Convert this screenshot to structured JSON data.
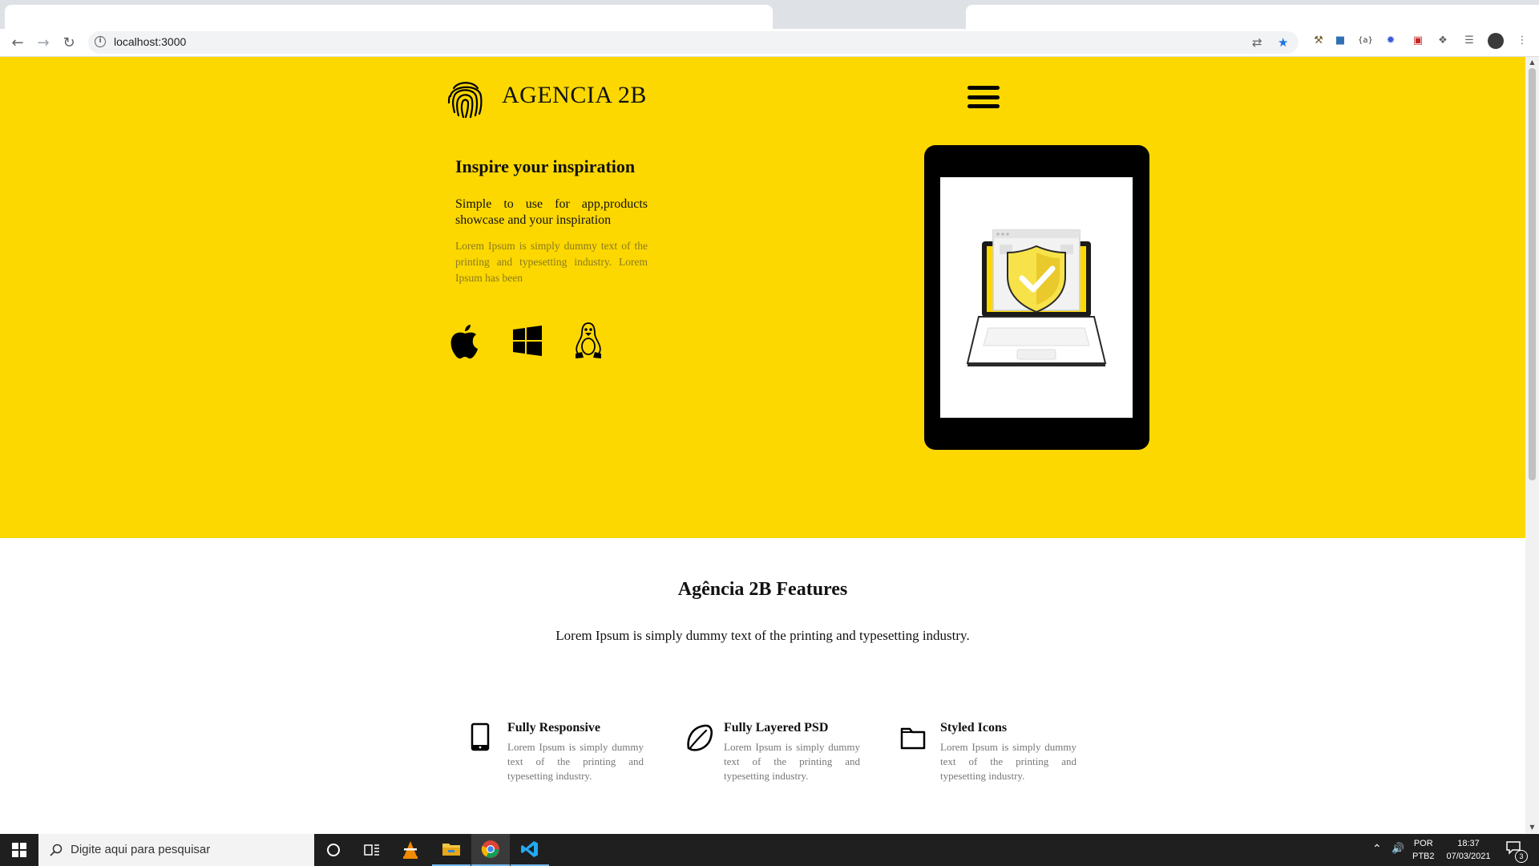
{
  "browser": {
    "url": "localhost:3000"
  },
  "hero": {
    "brand": "AGENCIA 2B",
    "title": "Inspire your inspiration",
    "subtitle": "Simple to use for app,products showcase and your inspiration",
    "description": "Lorem Ipsum is simply dummy text of the printing and typesetting industry. Lorem Ipsum has been",
    "platform_icons": [
      "apple-icon",
      "windows-icon",
      "linux-icon"
    ],
    "background_color": "#fcd800"
  },
  "features": {
    "title": "Agência 2B Features",
    "subtitle": "Lorem Ipsum is simply dummy text of the printing and typesetting industry.",
    "items": [
      {
        "icon": "mobile-icon",
        "title": "Fully Responsive",
        "desc": "Lorem Ipsum is simply dummy text of the printing and typesetting industry."
      },
      {
        "icon": "leaf-icon",
        "title": "Fully Layered PSD",
        "desc": "Lorem Ipsum is simply dummy text of the printing and typesetting industry."
      },
      {
        "icon": "folder-icon",
        "title": "Styled Icons",
        "desc": "Lorem Ipsum is simply dummy text of the printing and typesetting industry."
      }
    ]
  },
  "taskbar": {
    "search_placeholder": "Digite aqui para pesquisar",
    "lang_top": "POR",
    "lang_bottom": "PTB2",
    "time": "18:37",
    "date": "07/03/2021",
    "notification_count": "3"
  }
}
